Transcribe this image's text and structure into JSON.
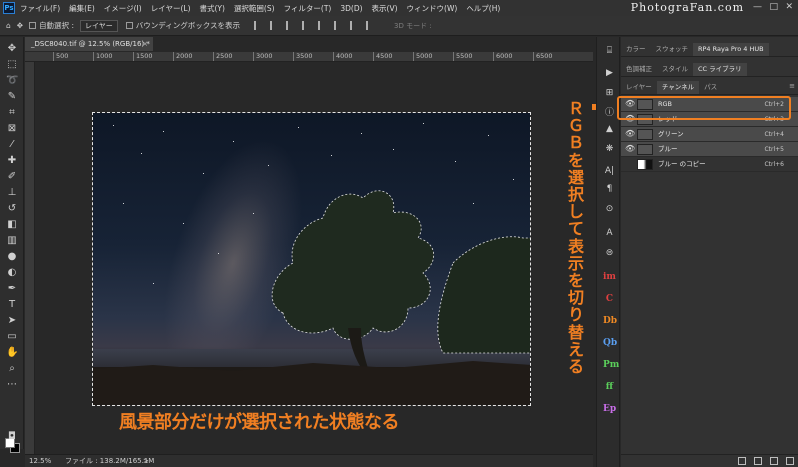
{
  "app": {
    "menu": [
      "ファイル(F)",
      "編集(E)",
      "イメージ(I)",
      "レイヤー(L)",
      "書式(Y)",
      "選択範囲(S)",
      "フィルター(T)",
      "3D(D)",
      "表示(V)",
      "ウィンドウ(W)",
      "ヘルプ(H)"
    ],
    "site_logo": "PhotograFan.com",
    "win_controls": [
      "—",
      "□",
      "✕"
    ]
  },
  "options": {
    "auto_select_label": "自動選択 :",
    "auto_select_value": "レイヤー",
    "bounding_box_label": "バウンディングボックスを表示",
    "mode_3d": "3D モード :"
  },
  "document": {
    "tab_title": "_DSC8040.tif @ 12.5% (RGB/16) *",
    "tab_close": "×",
    "ruler_ticks": [
      "500",
      "1000",
      "1500",
      "2000",
      "2500",
      "3000",
      "3500",
      "4000",
      "4500",
      "5000",
      "5500",
      "6000",
      "6500"
    ]
  },
  "status": {
    "zoom": "12.5%",
    "file_info": "ファイル : 138.2M/165.1M",
    "arrow": ">"
  },
  "annotations": {
    "bottom_caption": "風景部分だけが選択された状態なる",
    "side_caption": "ＲＧＢを選択して表示を切り替える"
  },
  "panels": {
    "top_tabs": [
      "カラー",
      "スウォッチ",
      "RP4 Raya Pro 4 HUB"
    ],
    "mid_tabs": [
      "色調補正",
      "スタイル",
      "CC ライブラリ"
    ],
    "layer_tabs": [
      "レイヤー",
      "チャンネル",
      "パス"
    ],
    "menu_icon": "≡",
    "channels": [
      {
        "name": "RGB",
        "shortcut": "Ctrl+2"
      },
      {
        "name": "レッド",
        "shortcut": "Ctrl+3"
      },
      {
        "name": "グリーン",
        "shortcut": "Ctrl+4"
      },
      {
        "name": "ブルー",
        "shortcut": "Ctrl+5"
      },
      {
        "name": "ブルー のコピー",
        "shortcut": "Ctrl+6"
      }
    ]
  },
  "plugin_icons": [
    "A",
    "im",
    "C",
    "Db",
    "Qb",
    "Pm",
    "ff",
    "Ep"
  ],
  "colors": {
    "accent_orange": "#f07f22",
    "ui_dark": "#323232"
  }
}
